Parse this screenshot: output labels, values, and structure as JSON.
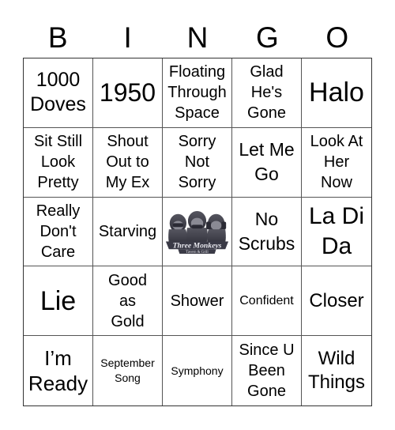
{
  "header": {
    "letters": [
      "B",
      "I",
      "N",
      "G",
      "O"
    ]
  },
  "board": {
    "cells": [
      [
        "1000\nDoves",
        "1950",
        "Floating\nThrough\nSpace",
        "Glad\nHe's\nGone",
        "Halo"
      ],
      [
        "Sit Still\nLook\nPretty",
        "Shout\nOut to\nMy Ex",
        "Sorry\nNot\nSorry",
        "Let Me\nGo",
        "Look At\nHer\nNow"
      ],
      [
        "Really\nDon't\nCare",
        "Starving",
        "",
        "No\nScrubs",
        "La Di\nDa"
      ],
      [
        "Lie",
        "Good\nas\nGold",
        "Shower",
        "Confident",
        "Closer"
      ],
      [
        "I’m\nReady",
        "September\nSong",
        "Symphony",
        "Since U\nBeen\nGone",
        "Wild\nThings"
      ]
    ],
    "free_space": {
      "type": "logo",
      "logo_text": "Three Monkeys",
      "logo_subtext": "Tavern & Grill"
    }
  },
  "colors": {
    "grid_line": "#555555",
    "text": "#000000",
    "logo_dark": "#3a3a46",
    "logo_mid": "#6c6c78"
  }
}
